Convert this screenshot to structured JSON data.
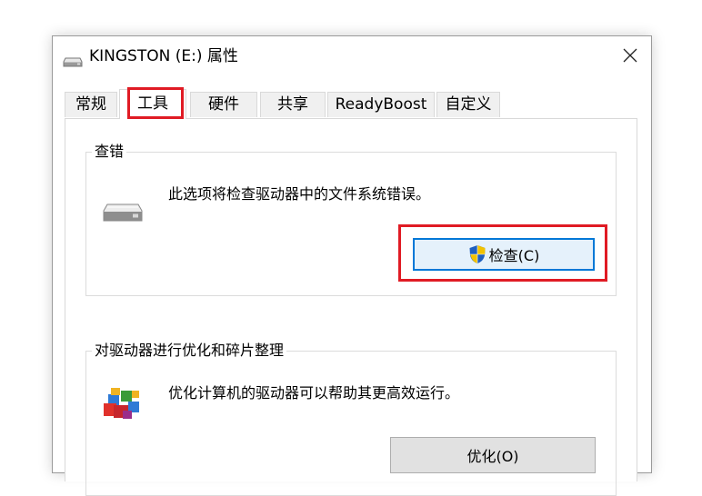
{
  "window": {
    "title": "KINGSTON (E:) 属性",
    "icon": "drive-icon",
    "close_icon": "close-icon"
  },
  "tabs": [
    {
      "label": "常规",
      "active": false
    },
    {
      "label": "工具",
      "active": true,
      "highlighted": true
    },
    {
      "label": "硬件",
      "active": false
    },
    {
      "label": "共享",
      "active": false
    },
    {
      "label": "ReadyBoost",
      "active": false
    },
    {
      "label": "自定义",
      "active": false
    }
  ],
  "error_check": {
    "title": "查错",
    "description": "此选项将检查驱动器中的文件系统错误。",
    "button_label": "检查(C)",
    "button_icon": "uac-shield-icon",
    "highlighted": true
  },
  "optimize": {
    "title": "对驱动器进行优化和碎片整理",
    "description": "优化计算机的驱动器可以帮助其更高效运行。",
    "button_label": "优化(O)",
    "icon": "defrag-icon"
  },
  "colors": {
    "highlight": "#e01b24",
    "focus_border": "#0078d7"
  }
}
